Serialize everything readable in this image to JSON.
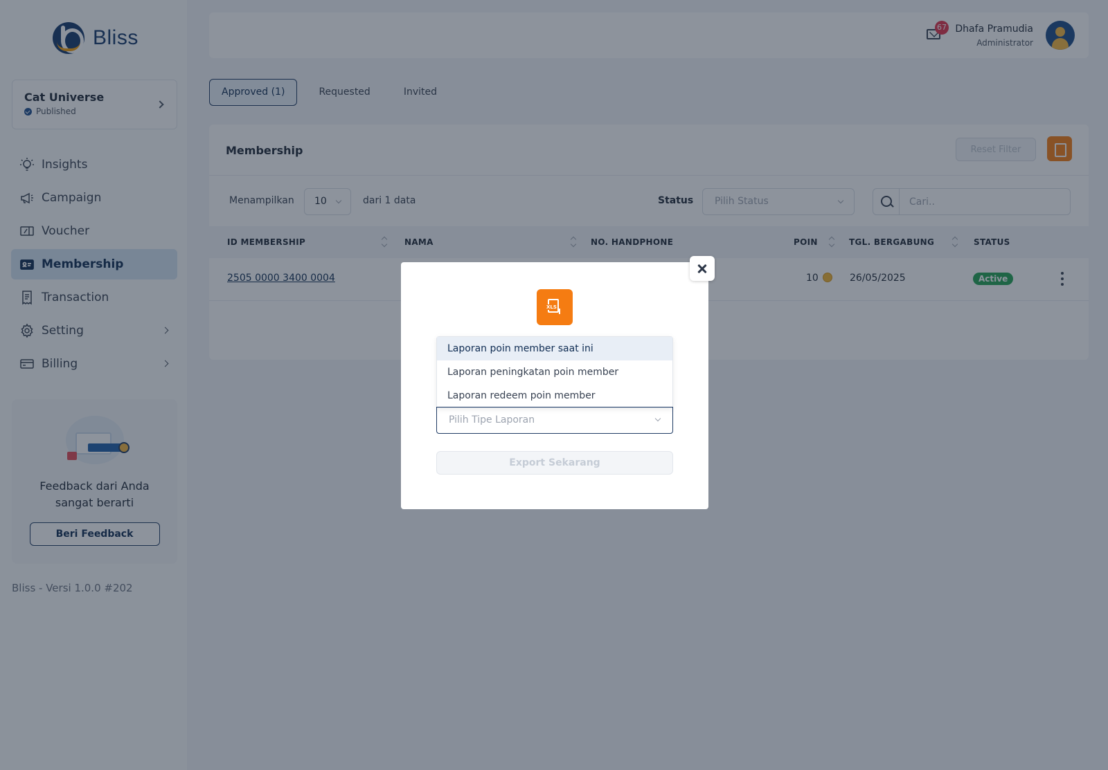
{
  "app": {
    "name": "Bliss",
    "version": "Bliss - Versi 1.0.0 #202"
  },
  "workspace": {
    "name": "Cat Universe",
    "status": "Published"
  },
  "nav": [
    {
      "label": "Insights",
      "icon": "lightbulb-icon",
      "active": false
    },
    {
      "label": "Campaign",
      "icon": "megaphone-icon",
      "active": false
    },
    {
      "label": "Voucher",
      "icon": "ticket-icon",
      "active": false
    },
    {
      "label": "Membership",
      "icon": "id-card-icon",
      "active": true
    },
    {
      "label": "Transaction",
      "icon": "receipt-icon",
      "active": false
    },
    {
      "label": "Setting",
      "icon": "gear-icon",
      "active": false,
      "expandable": true
    },
    {
      "label": "Billing",
      "icon": "credit-card-icon",
      "active": false,
      "expandable": true
    }
  ],
  "feedback": {
    "text": "Feedback dari Anda sangat berarti",
    "button": "Beri Feedback"
  },
  "header": {
    "notification_count": "67",
    "user_name": "Dhafa Pramudia",
    "user_role": "Administrator"
  },
  "tabs": [
    {
      "label": "Approved (1)",
      "active": true
    },
    {
      "label": "Requested",
      "active": false
    },
    {
      "label": "Invited",
      "active": false
    }
  ],
  "card": {
    "title": "Membership",
    "reset_filter": "Reset Filter",
    "show_label": "Menampilkan",
    "per_page": "10",
    "of_label": "dari 1 data",
    "status_label": "Status",
    "status_placeholder": "Pilih Status",
    "search_placeholder": "Cari.."
  },
  "table": {
    "columns": [
      "ID MEMBERSHIP",
      "NAMA",
      "NO. HANDPHONE",
      "POIN",
      "TGL. BERGABUNG",
      "STATUS"
    ],
    "rows": [
      {
        "id": "2505 0000 3400 0004",
        "poin": "10",
        "date": "26/05/2025",
        "status": "Active"
      }
    ]
  },
  "modal": {
    "options": [
      "Laporan poin member saat ini",
      "Laporan peningkatan poin member",
      "Laporan redeem poin member"
    ],
    "select_placeholder": "Pilih Tipe Laporan",
    "export_button": "Export Sekarang",
    "icon_label": "XLS"
  },
  "colors": {
    "primary": "#14386b",
    "accent": "#f57c12",
    "active_badge": "#22a353",
    "notification": "#e0324b"
  }
}
